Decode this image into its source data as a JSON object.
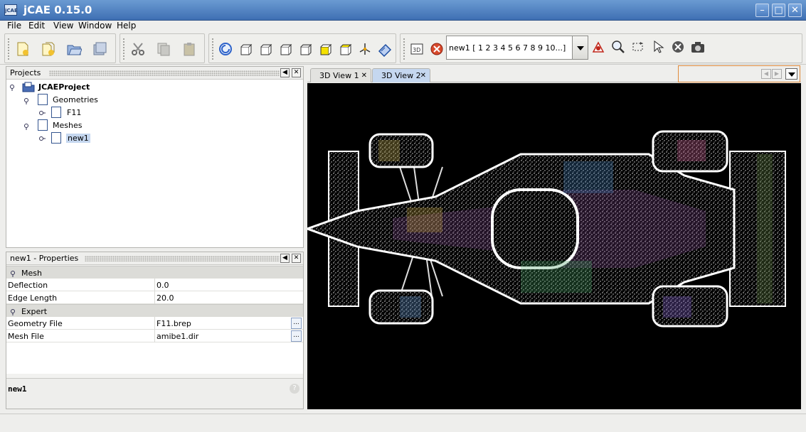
{
  "window": {
    "title": "jCAE 0.15.0",
    "icon_text": "jCAE"
  },
  "menu": [
    "File",
    "Edit",
    "View",
    "Window",
    "Help"
  ],
  "toolbar": {
    "combo_value": "new1 [ 1 2 3 4 5 6 7 8 9 10...]"
  },
  "projects_panel": {
    "title": "Projects",
    "tree": {
      "root": "JCAEProject",
      "geometries_label": "Geometries",
      "geometry_item": "F11",
      "meshes_label": "Meshes",
      "mesh_item": "new1"
    }
  },
  "properties_panel": {
    "title": "new1 - Properties",
    "sections": [
      {
        "name": "Mesh",
        "rows": [
          {
            "key": "Deflection",
            "value": "0.0"
          },
          {
            "key": "Edge Length",
            "value": "20.0"
          }
        ]
      },
      {
        "name": "Expert",
        "rows": [
          {
            "key": "Geometry File",
            "value": "F11.brep"
          },
          {
            "key": "Mesh File",
            "value": "amibe1.dir"
          }
        ]
      }
    ],
    "description": "new1"
  },
  "view_tabs": [
    {
      "label": "3D View 1",
      "active": false
    },
    {
      "label": "3D View 2",
      "active": true
    }
  ],
  "colors": {
    "accent": "#3e6fb3",
    "selection": "#c5d7ef",
    "viewport_bg": "#000000"
  }
}
